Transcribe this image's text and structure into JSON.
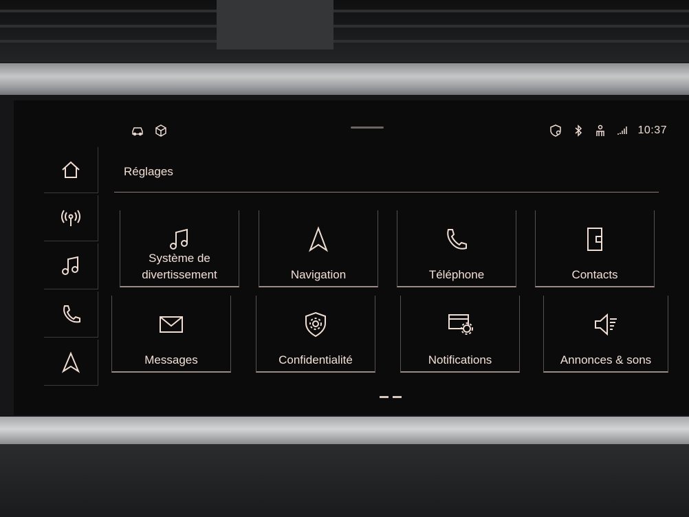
{
  "status_bar": {
    "left_icons": [
      "car-status-icon",
      "package-icon"
    ],
    "right_icons": [
      "privacy-location-icon",
      "bluetooth-icon",
      "passenger-icon",
      "lte-signal-icon"
    ],
    "time": "10:37"
  },
  "rail": {
    "items": [
      "home-icon",
      "radio-icon",
      "music-icon",
      "phone-icon",
      "navigation-icon"
    ]
  },
  "page": {
    "title": "Réglages"
  },
  "tiles": [
    {
      "label": "Système de divertissement",
      "icon": "music-note-icon"
    },
    {
      "label": "Navigation",
      "icon": "navigation-arrow-icon"
    },
    {
      "label": "Téléphone",
      "icon": "phone-handset-icon"
    },
    {
      "label": "Contacts",
      "icon": "address-book-icon"
    },
    {
      "label": "Messages",
      "icon": "envelope-icon"
    },
    {
      "label": "Confidentialité",
      "icon": "shield-gear-icon"
    },
    {
      "label": "Notifications",
      "icon": "notification-gear-icon"
    },
    {
      "label": "Annonces & sons",
      "icon": "speaker-icon"
    }
  ],
  "pagination": {
    "pages": 2
  },
  "colors": {
    "accent": "#f0ddd3",
    "screen_bg": "#0b0b0c",
    "divider": "#9a8d88"
  }
}
